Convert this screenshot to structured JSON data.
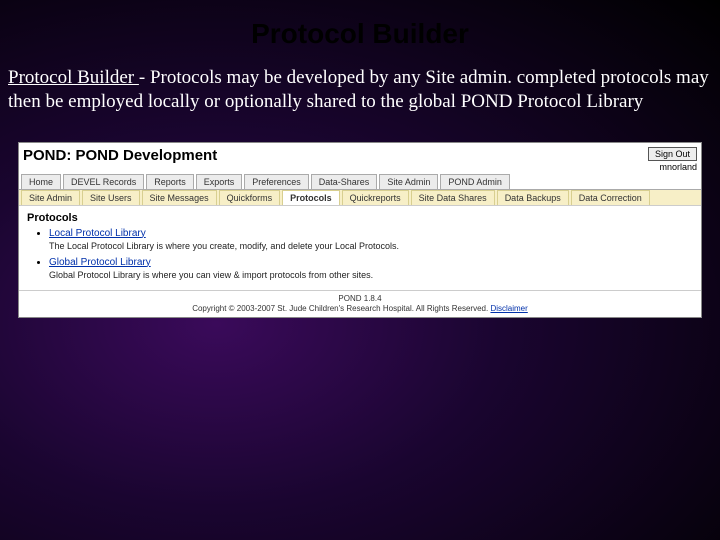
{
  "slide": {
    "title": "Protocol Builder",
    "lead": "Protocol Builder ",
    "body": "- Protocols may be developed by any Site admin. completed protocols may then be employed locally or optionally shared to the global POND Protocol Library"
  },
  "app": {
    "title": "POND: POND Development",
    "signout": "Sign Out",
    "username": "mnorland",
    "tabs_primary": [
      "Home",
      "DEVEL Records",
      "Reports",
      "Exports",
      "Preferences",
      "Data-Shares",
      "Site Admin",
      "POND Admin"
    ],
    "tabs_secondary": [
      "Site Admin",
      "Site Users",
      "Site Messages",
      "Quickforms",
      "Protocols",
      "Quickreports",
      "Site Data Shares",
      "Data Backups",
      "Data Correction"
    ],
    "active_secondary": "Protocols",
    "section_heading": "Protocols",
    "libraries": [
      {
        "name": "Local Protocol Library",
        "desc": "The Local Protocol Library is where you create, modify, and delete your Local Protocols."
      },
      {
        "name": "Global Protocol Library",
        "desc": "Global Protocol Library is where you can view & import protocols from other sites."
      }
    ],
    "footer_version": "POND 1.8.4",
    "footer_copyright": "Copyright © 2003-2007 St. Jude Children's Research Hospital. All Rights Reserved. ",
    "footer_disclaimer": "Disclaimer"
  }
}
